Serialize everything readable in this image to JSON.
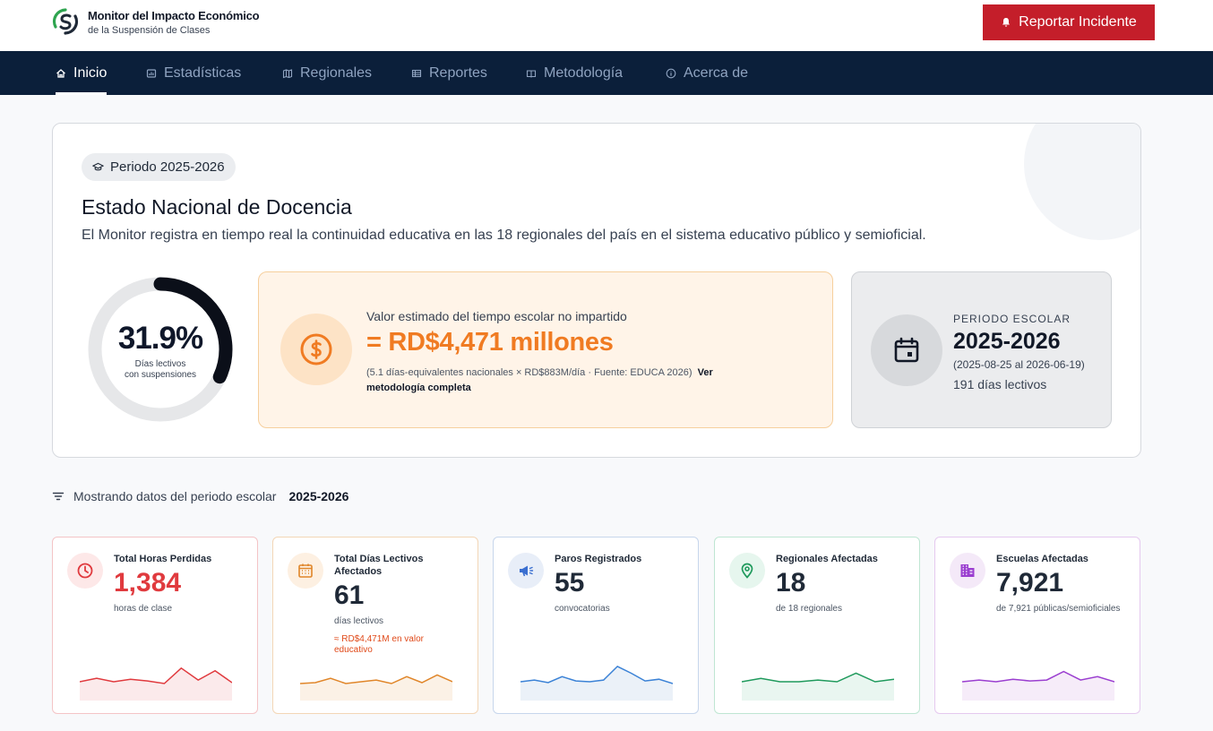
{
  "header": {
    "brand_title": "Monitor del Impacto Económico",
    "brand_subtitle": "de la Suspensión de Clases",
    "report_button": "Reportar Incidente",
    "logo_icon": "monitor-logo-icon",
    "report_icon": "bell-icon"
  },
  "nav": {
    "items": [
      {
        "label": "Inicio",
        "icon": "home-icon",
        "active": true
      },
      {
        "label": "Estadísticas",
        "icon": "stats-icon",
        "active": false
      },
      {
        "label": "Regionales",
        "icon": "map-icon",
        "active": false
      },
      {
        "label": "Reportes",
        "icon": "table-icon",
        "active": false
      },
      {
        "label": "Metodología",
        "icon": "book-icon",
        "active": false
      },
      {
        "label": "Acerca de",
        "icon": "info-icon",
        "active": false
      }
    ]
  },
  "hero": {
    "period_chip": "Periodo 2025-2026",
    "title": "Estado Nacional de Docencia",
    "description": "El Monitor registra en tiempo real la continuidad educativa en las 18 regionales del país en el sistema educativo público y semioficial.",
    "donut": {
      "percent_text": "31.9%",
      "percent_value": 31.9,
      "label_line1": "Días lectivos",
      "label_line2": "con suspensiones"
    },
    "value_card": {
      "label": "Valor estimado del tiempo escolar no impartido",
      "amount": "= RD$4,471 millones",
      "note": "(5.1 días-equivalentes nacionales × RD$883M/día · Fuente: EDUCA 2026)",
      "link": "Ver metodología completa",
      "icon": "dollar-circle-icon"
    },
    "school_card": {
      "kicker": "PERIODO ESCOLAR",
      "year": "2025-2026",
      "range": "(2025-08-25 al 2026-06-19)",
      "days": "191 días lectivos",
      "icon": "calendar-icon"
    }
  },
  "filter": {
    "label": "Mostrando datos del periodo escolar",
    "value": "2025-2026",
    "icon": "filter-icon"
  },
  "stats": [
    {
      "title": "Total Horas Perdidas",
      "value": "1,384",
      "unit": "horas de clase",
      "extra": "",
      "color": "#e03a3e",
      "border": "#f4c4c6",
      "icon_bg": "#fde8e8",
      "icon": "clock-icon",
      "spark": [
        22,
        26,
        22,
        25,
        23,
        20,
        38,
        24,
        35,
        21
      ]
    },
    {
      "title": "Total Días Lectivos Afectados",
      "value": "61",
      "unit": "días lectivos",
      "extra": "≈ RD$4,471M en valor educativo",
      "color": "#1f2937",
      "border": "#f3d6b6",
      "icon_bg": "#fdf0e2",
      "icon": "calendar-grid-icon",
      "spark": [
        20,
        21,
        26,
        20,
        22,
        24,
        20,
        28,
        21,
        30,
        22
      ]
    },
    {
      "title": "Paros Registrados",
      "value": "55",
      "unit": "convocatorias",
      "extra": "",
      "color": "#1f2937",
      "border": "#c7d6ec",
      "icon_bg": "#e8eef8",
      "icon": "megaphone-icon",
      "spark": [
        22,
        24,
        21,
        28,
        23,
        22,
        24,
        40,
        32,
        23,
        25,
        20
      ]
    },
    {
      "title": "Regionales Afectadas",
      "value": "18",
      "unit": "de 18 regionales",
      "extra": "",
      "color": "#1f2937",
      "border": "#bfe6d3",
      "icon_bg": "#e6f6ee",
      "icon": "map-pin-icon",
      "spark": [
        22,
        26,
        22,
        22,
        24,
        22,
        32,
        22,
        25
      ]
    },
    {
      "title": "Escuelas Afectadas",
      "value": "7,921",
      "unit": "de 7,921 públicas/semioficiales",
      "extra": "",
      "color": "#1f2937",
      "border": "#e5c9ef",
      "icon_bg": "#f4e9f8",
      "icon": "building-icon",
      "spark": [
        22,
        24,
        22,
        25,
        23,
        24,
        34,
        24,
        28,
        22
      ]
    }
  ]
}
